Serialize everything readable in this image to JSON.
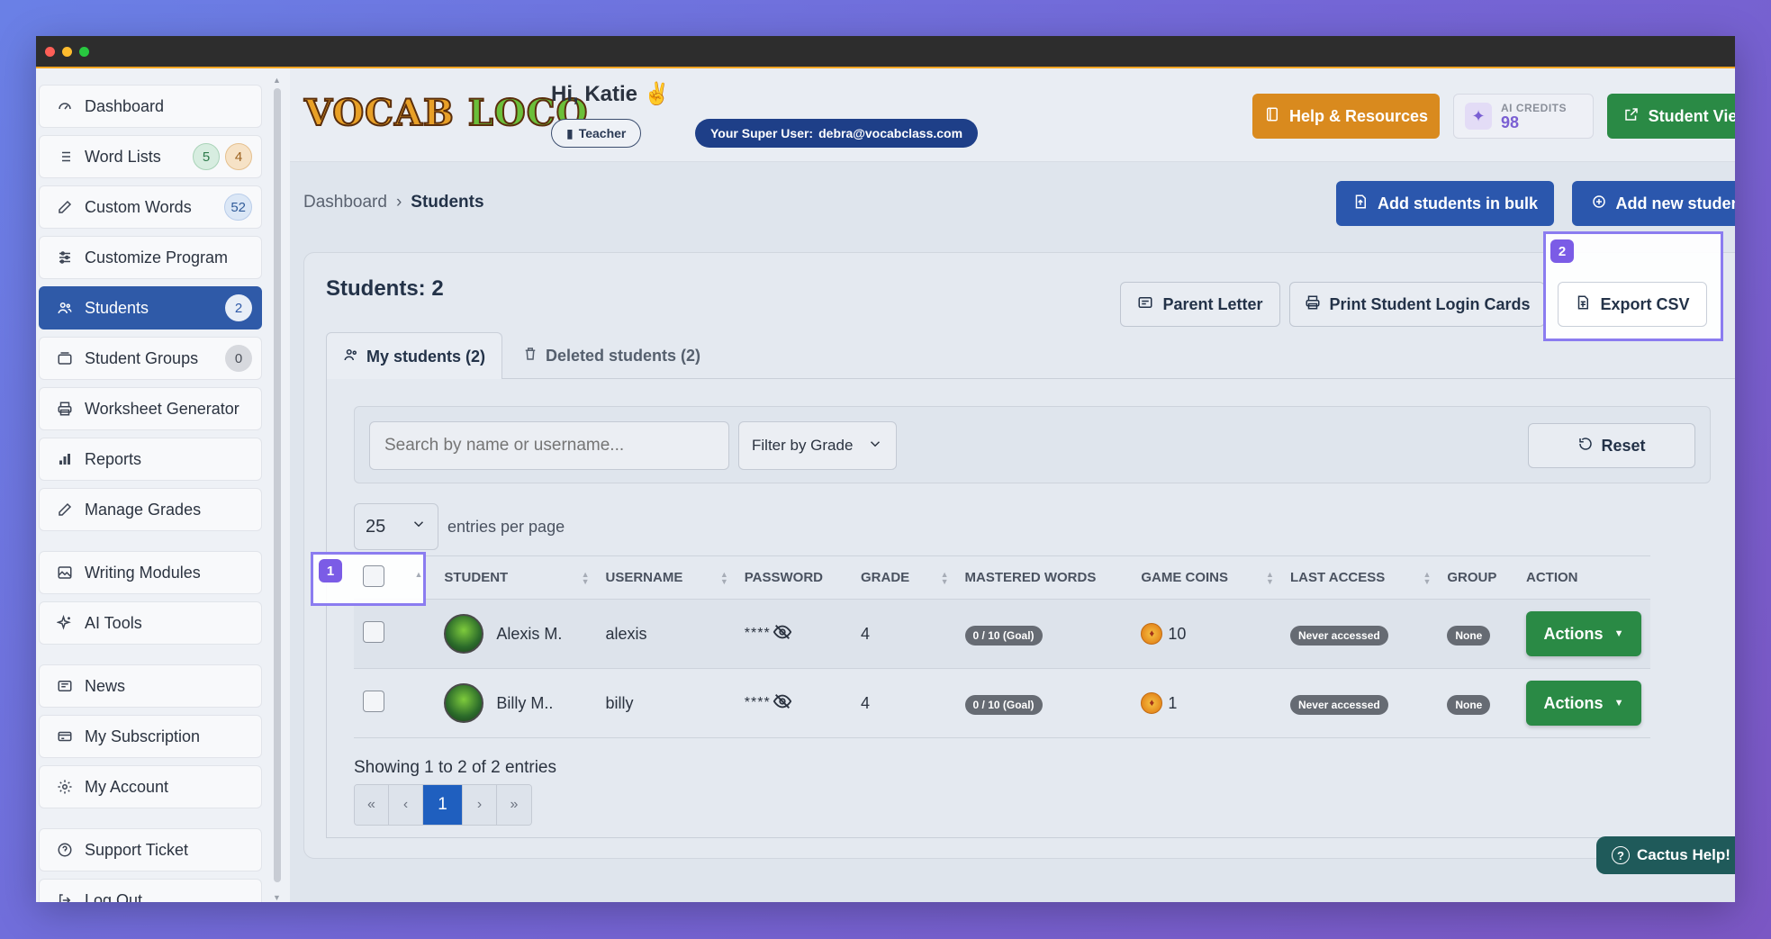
{
  "sidebar": {
    "items": [
      {
        "label": "Dashboard",
        "icon": "gauge-icon"
      },
      {
        "label": "Word Lists",
        "icon": "list-icon",
        "badges": [
          "5",
          "4"
        ]
      },
      {
        "label": "Custom Words",
        "icon": "edit-icon",
        "badges": [
          "52"
        ]
      },
      {
        "label": "Customize Program",
        "icon": "sliders-icon"
      },
      {
        "label": "Students",
        "icon": "users-icon",
        "badges": [
          "2"
        ],
        "active": true
      },
      {
        "label": "Student Groups",
        "icon": "folder-icon",
        "badges": [
          "0"
        ]
      },
      {
        "label": "Worksheet Generator",
        "icon": "printer-icon"
      },
      {
        "label": "Reports",
        "icon": "bar-chart-icon"
      },
      {
        "label": "Manage Grades",
        "icon": "edit-icon"
      },
      {
        "label": "Writing Modules",
        "icon": "image-icon"
      },
      {
        "label": "AI Tools",
        "icon": "sparkles-icon"
      },
      {
        "label": "News",
        "icon": "newspaper-icon"
      },
      {
        "label": "My Subscription",
        "icon": "credit-card-icon"
      },
      {
        "label": "My Account",
        "icon": "gear-icon"
      },
      {
        "label": "Support Ticket",
        "icon": "help-circle-icon"
      },
      {
        "label": "Log Out",
        "icon": "logout-icon"
      }
    ]
  },
  "header": {
    "logo_part1": "VOCAB ",
    "logo_part2": "LOCO",
    "greeting": "Hi, Katie ✌️",
    "role": "Teacher",
    "super_user_label": "Your Super User:",
    "super_user_email": "debra@vocabclass.com",
    "help_label": "Help & Resources",
    "credits_label": "AI CREDITS",
    "credits_value": "98",
    "student_view_label": "Student View"
  },
  "breadcrumb": {
    "root": "Dashboard",
    "sep": "›",
    "current": "Students"
  },
  "actions": {
    "bulk": "Add students in bulk",
    "add_new": "Add new student"
  },
  "card": {
    "title": "Students: 2",
    "parent_letter": "Parent Letter",
    "print_cards": "Print Student Login Cards",
    "export_csv": "Export CSV",
    "tabs": {
      "mine": "My students (2)",
      "deleted": "Deleted students (2)"
    }
  },
  "filters": {
    "search_placeholder": "Search by name or username...",
    "grade_filter": "Filter by Grade",
    "reset": "Reset",
    "per_page_value": "25",
    "per_page_label": "entries per page"
  },
  "table": {
    "columns": [
      "Student",
      "Username",
      "Password",
      "Grade",
      "Mastered Words",
      "Game Coins",
      "Last Access",
      "Group",
      "Action"
    ],
    "rows": [
      {
        "student": "Alexis M.",
        "username": "alexis",
        "password": "****",
        "grade": "4",
        "mastered": "0 / 10 (Goal)",
        "coins": "10",
        "last_access": "Never accessed",
        "group": "None",
        "action": "Actions"
      },
      {
        "student": "Billy M..",
        "username": "billy",
        "password": "****",
        "grade": "4",
        "mastered": "0 / 10 (Goal)",
        "coins": "1",
        "last_access": "Never accessed",
        "group": "None",
        "action": "Actions"
      }
    ],
    "showing": "Showing 1 to 2 of 2 entries"
  },
  "pager": {
    "first": "«",
    "prev": "‹",
    "current": "1",
    "next": "›",
    "last": "»"
  },
  "help_widget": "Cactus Help!",
  "annotations": {
    "one": "1",
    "two": "2"
  }
}
